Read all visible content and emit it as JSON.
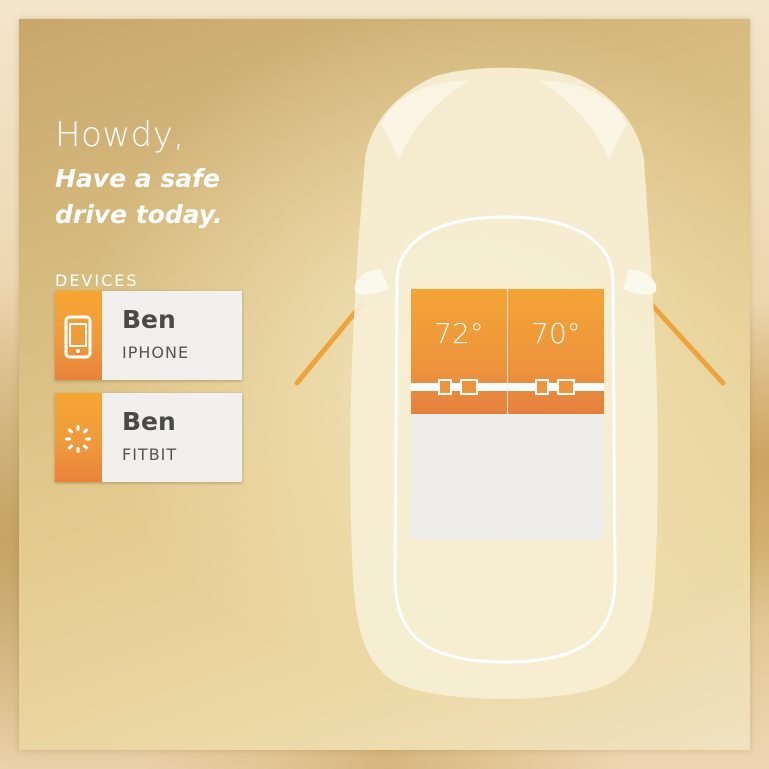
{
  "greeting": {
    "title": "Howdy,",
    "subtitle_line1": "Have a safe",
    "subtitle_line2": "drive today."
  },
  "devices": {
    "heading": "DEVICES",
    "items": [
      {
        "name": "Ben",
        "type": "IPHONE",
        "icon": "phone-icon"
      },
      {
        "name": "Ben",
        "type": "FITBIT",
        "icon": "fitbit-icon"
      }
    ]
  },
  "car": {
    "seats": [
      {
        "position": "driver",
        "temperature": "72°",
        "seatbelt": "buckled"
      },
      {
        "position": "passenger",
        "temperature": "70°",
        "seatbelt": "buckled"
      }
    ]
  },
  "colors": {
    "accent_orange": "#f09a3c",
    "card_background": "#f1f0ee",
    "text_dark": "#4a4a4a"
  }
}
